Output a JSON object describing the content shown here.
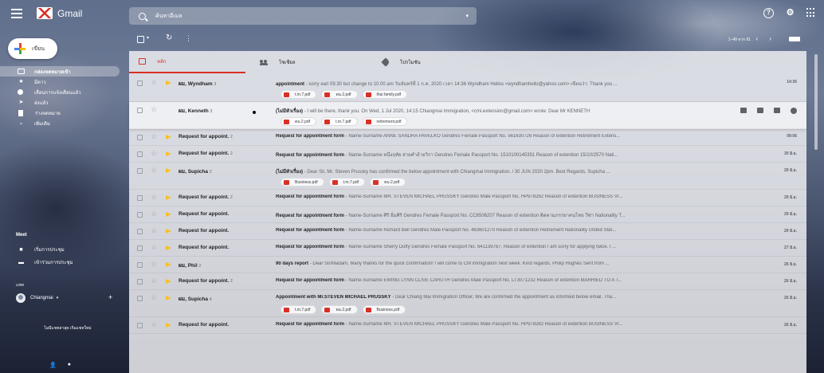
{
  "app": {
    "name": "Gmail",
    "search_text": "ค้นหาอีเมล",
    "compose_label": "เขียน"
  },
  "toolbar": {
    "refresh_icon": "↻",
    "more_icon": "⋮",
    "page_count": "1–49 จาก 91",
    "nav_icons": "‹ ›"
  },
  "top_icons": {
    "help": "?",
    "settings": "⚙"
  },
  "sidebar": {
    "items": [
      {
        "label": "กล่องจดหมายเข้า",
        "icon": "inbox-icon",
        "active": true
      },
      {
        "label": "มีดาว",
        "icon": "star-icon",
        "active": false
      },
      {
        "label": "เลื่อนการแจ้งเตือนแล้ว",
        "icon": "clock-icon",
        "active": false
      },
      {
        "label": "ส่งแล้ว",
        "icon": "send-icon",
        "active": false
      },
      {
        "label": "ร่างจดหมาย",
        "icon": "draft-icon",
        "active": false
      },
      {
        "label": "เพิ่มเติม",
        "icon": "chevron-down-icon",
        "active": false
      }
    ],
    "meet_title": "Meet",
    "meet_items": [
      {
        "label": "เริ่มการประชุม",
        "icon": "video-icon"
      },
      {
        "label": "เข้าร่วมการประชุม",
        "icon": "keyboard-icon"
      }
    ],
    "hangouts_title": "แชท",
    "hangouts_user": "Chiangmai",
    "hangouts_note": "ไม่มีแชทล่าสุด เริ่มแชทใหม่"
  },
  "tabs": [
    {
      "label": "หลัก",
      "icon": "inbox-icon",
      "active": true
    },
    {
      "label": "โซเชียล",
      "icon": "people-icon",
      "active": false
    },
    {
      "label": "โปรโมชัน",
      "icon": "tag-icon",
      "active": false
    }
  ],
  "emails": [
    {
      "sender": "ผม, Wyndham",
      "count": "3",
      "subject": "appointment",
      "snippet": " - sorry earl 09.30 but change to 10.00 am วันจันทร์ที่ 1 ก.ค. 2020 เวลา 14:36 Wyndham Hellos <wyndhamhello@yahoo.com> เขียนว่า: Thank you ...",
      "date": "14:36",
      "important": true,
      "attachments": [
        "t.m.7.pdf",
        "ตม.2.pdf",
        "thai family.pdf"
      ],
      "hover": false
    },
    {
      "sender": "ผม, Kenneth",
      "count": "3",
      "subject": "(ไม่มีหัวเรื่อง)",
      "snippet": " - I will be there, thank you. On Wed, 1 Jul 2020, 14:15 Chiangmai Immigration, <cmi.extension@gmail.com> wrote: Dear Mr KENNETH",
      "date": "",
      "important": false,
      "attachments": [
        "ตม.2.pdf",
        "t.m.7.pdf",
        "retirement.pdf"
      ],
      "hover": true
    },
    {
      "sender": "Request for appoint.",
      "count": "2",
      "subject": "Request for appointment form",
      "snippet": " - Name-Surname ANNE SANDRA PAVELKO Gendres Female Passport No. 561630726 Reason of extention Retirement Extens...",
      "date": "09:06",
      "important": true,
      "attachments": [],
      "hover": false
    },
    {
      "sender": "Request for appoint.",
      "count": "2",
      "subject": "Request for appointment form",
      "snippet": " - Name-Surname หนึ่งฤทัย สายคำอ้ายวิรา Gendres Female Passport No. 1510100145351 Reason of extention 15/10/2570 Nati...",
      "date": "30 มิ.ย.",
      "important": true,
      "attachments": [],
      "hover": false
    },
    {
      "sender": "ผม, Supicha",
      "count": "2",
      "subject": "(ไม่มีหัวเรื่อง)",
      "snippet": " - Dear Sir, Mr. Steven Prussky has confirmed the below appointment with Chiangmai Immigration. / 30 JUN 2020 2pm. Best Regards, Supicha ...",
      "date": "29 มิ.ย.",
      "important": true,
      "attachments": [
        "Business.pdf",
        "t.m.7.pdf",
        "ตม.2.pdf"
      ],
      "hover": false
    },
    {
      "sender": "Request for appoint.",
      "count": "2",
      "subject": "Request for appointment form",
      "snippet": " - Name-Surname MR. STEVEN MICHAEL PRUSSKY Gendres Male Passport No. HP978282 Reason of extention BUSINESS VI...",
      "date": "29 มิ.ย.",
      "important": true,
      "attachments": [],
      "hover": false
    },
    {
      "sender": "Request for appoint.",
      "count": "",
      "subject": "Request for appointment form",
      "snippet": " - Name-Surname ศิริ อิ่มศิริ Gendres Female Passport No. CC6506207 Reason of extention ติดตามภรรยาคนไทย วีซ่า Nationality T...",
      "date": "29 มิ.ย.",
      "important": true,
      "attachments": [],
      "hover": false
    },
    {
      "sender": "Request for appoint.",
      "count": "",
      "subject": "Request for appointment form",
      "snippet": " - Name-Surname Richard Bell Gendres Male Passport No. 483601270 Reason of extention Retirement Nationality United Stat...",
      "date": "29 มิ.ย.",
      "important": true,
      "attachments": [],
      "hover": false
    },
    {
      "sender": "Request for appoint.",
      "count": "",
      "subject": "Request for appointment form",
      "snippet": " - Name-Surname Sherry Duffy Gendres Female Passport No. 641139787, Reason of extention I am sorry for applying twice. I ...",
      "date": "27 มิ.ย.",
      "important": true,
      "attachments": [],
      "hover": false
    },
    {
      "sender": "ผม, Phil",
      "count": "2",
      "subject": "90 days report",
      "snippet": " - Dear Sir/Madam, Many thanks for the quick confirmation! I will come to CM immigration next week. Kind regards, Philip Hughes Sent from ...",
      "date": "26 มิ.ย.",
      "important": true,
      "attachments": [],
      "hover": false
    },
    {
      "sender": "Request for appoint.",
      "count": "2",
      "subject": "Request for appointment form",
      "snippet": " - Name-Surname EWING LYNN CLIVE CARUTH Gendres Male Passport No. LT3071232 Reason of extention MARRIED TO A T...",
      "date": "26 มิ.ย.",
      "important": true,
      "attachments": [],
      "hover": false
    },
    {
      "sender": "ผม, Supicha",
      "count": "4",
      "subject": "Appointment with Mr.STEVEN MICHAEL PRUSSKY",
      "snippet": " - Dear Chiang Mai Immigration Officer, We are confirmed the appointment as informed below email. Tha...",
      "date": "26 มิ.ย.",
      "important": true,
      "attachments": [
        "t.m.7.pdf",
        "ตม.2.pdf",
        "Business.pdf"
      ],
      "hover": false
    },
    {
      "sender": "Request for appoint.",
      "count": "",
      "subject": "Request for appointment form",
      "snippet": " - Name-Surname MR. STEVEN MICHAEL PRUSSKY Gendres Male Passport No. HP978282 Reason of extention BUSINESS VI...",
      "date": "26 มิ.ย.",
      "important": true,
      "attachments": [],
      "hover": false
    }
  ]
}
